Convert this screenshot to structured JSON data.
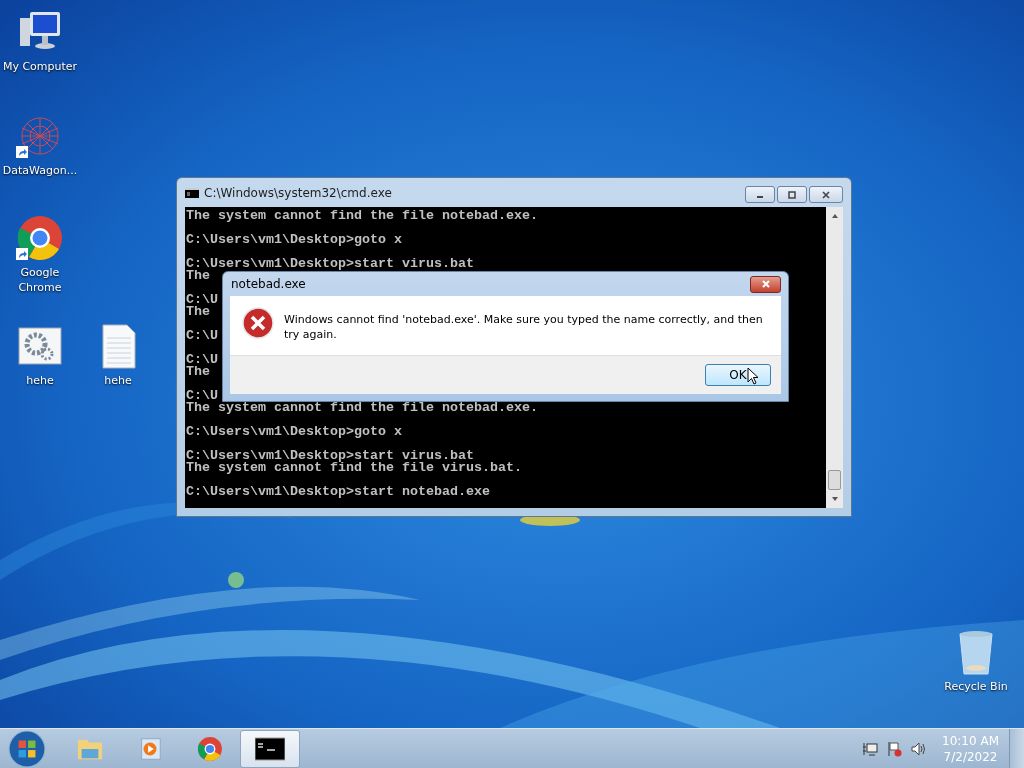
{
  "desktop_icons": [
    {
      "label": "My Computer",
      "kind": "computer",
      "shortcut": false
    },
    {
      "label": "DataWagon...",
      "kind": "network",
      "shortcut": true
    },
    {
      "label": "Google Chrome",
      "kind": "chrome",
      "shortcut": true
    },
    {
      "label": "hehe",
      "kind": "settings",
      "shortcut": false
    },
    {
      "label": "hehe",
      "kind": "document",
      "shortcut": false
    },
    {
      "label": "Recycle Bin",
      "kind": "recycle",
      "shortcut": false
    }
  ],
  "console_window": {
    "title": "C:\\Windows\\system32\\cmd.exe",
    "blocks": [
      [
        "The system cannot find the file notebad.exe."
      ],
      [
        "C:\\Users\\vm1\\Desktop>goto x"
      ],
      [
        "C:\\Users\\vm1\\Desktop>start virus.bat",
        "The"
      ],
      [
        "C:\\U",
        "The"
      ],
      [
        "C:\\U"
      ],
      [
        "C:\\U",
        "The"
      ],
      [
        "C:\\U",
        "The system cannot find the file notebad.exe."
      ],
      [
        "C:\\Users\\vm1\\Desktop>goto x"
      ],
      [
        "C:\\Users\\vm1\\Desktop>start virus.bat",
        "The system cannot find the file virus.bat."
      ],
      [
        "C:\\Users\\vm1\\Desktop>start notebad.exe"
      ]
    ]
  },
  "dialog": {
    "title": "notebad.exe",
    "message": "Windows cannot find 'notebad.exe'. Make sure you typed the name correctly, and then try again.",
    "button": "OK"
  },
  "taskbar": {
    "items": [
      {
        "kind": "explorer",
        "active": false
      },
      {
        "kind": "media",
        "active": false
      },
      {
        "kind": "chrome",
        "active": false
      },
      {
        "kind": "console",
        "active": true
      }
    ],
    "tray": [
      {
        "kind": "network"
      },
      {
        "kind": "flag"
      },
      {
        "kind": "volume"
      }
    ],
    "time": "10:10 AM",
    "date": "7/2/2022"
  }
}
